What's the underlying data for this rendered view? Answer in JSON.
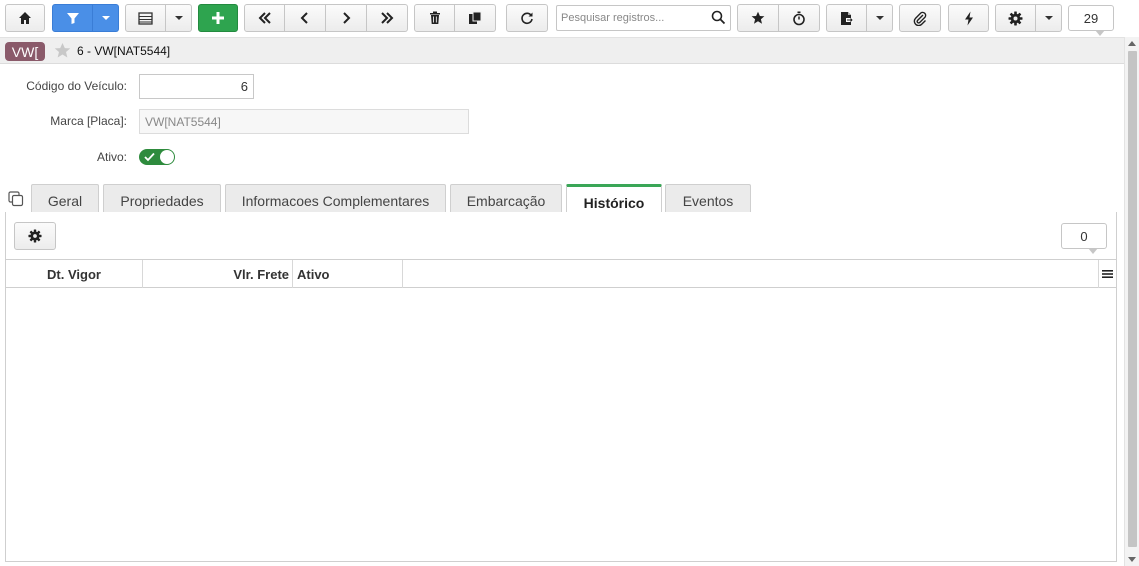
{
  "toolbar": {
    "search_placeholder": "Pesquisar registros...",
    "record_count": "29",
    "icons": [
      "home-icon",
      "filter-icon",
      "table-icon",
      "plus-icon",
      "first-icon",
      "prev-icon",
      "next-icon",
      "last-icon",
      "trash-icon",
      "copy-icon",
      "refresh-icon",
      "search-icon",
      "star-icon",
      "timer-icon",
      "report-icon",
      "paperclip-icon",
      "bolt-icon",
      "gear-icon"
    ]
  },
  "header": {
    "badge": "VW[",
    "title": "6 - VW[NAT5544]"
  },
  "form": {
    "codigo_label": "Código do Veículo:",
    "codigo_value": "6",
    "marca_label": "Marca [Placa]:",
    "marca_value": "VW[NAT5544]",
    "ativo_label": "Ativo:",
    "ativo_value": true
  },
  "tabs": [
    {
      "label": "Geral",
      "active": false
    },
    {
      "label": "Propriedades",
      "active": false
    },
    {
      "label": "Informacoes Complementares",
      "active": false
    },
    {
      "label": "Embarcação",
      "active": false
    },
    {
      "label": "Histórico",
      "active": true
    },
    {
      "label": "Eventos",
      "active": false
    }
  ],
  "grid": {
    "count": "0",
    "columns": [
      "Dt. Vigor",
      "Vlr. Frete",
      "Ativo"
    ],
    "rows": []
  },
  "colors": {
    "accent_green": "#2ea44f",
    "filter_blue": "#4a8fe7",
    "badge": "#8a5a6a"
  }
}
